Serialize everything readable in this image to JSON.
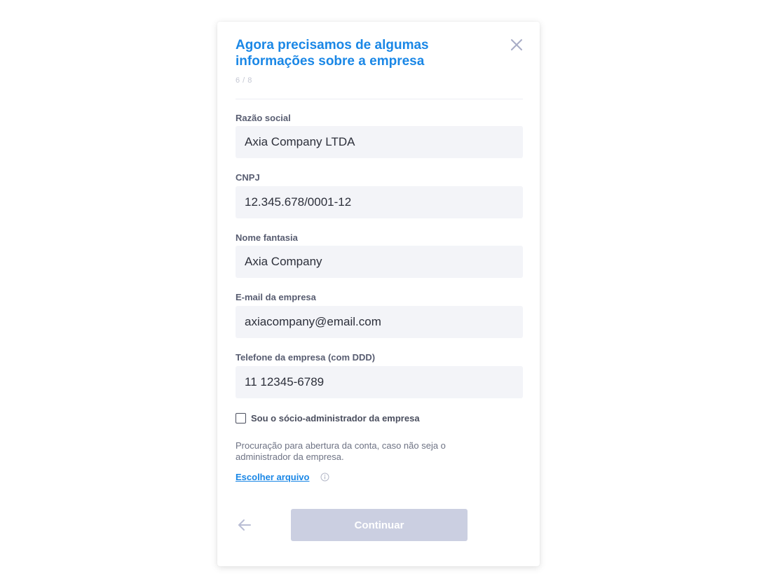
{
  "modal": {
    "title": "Agora precisamos de algumas informações sobre a empresa",
    "step": "6 / 8",
    "close_icon": "close-icon"
  },
  "form": {
    "fields": [
      {
        "label": "Razão social",
        "value": "Axia Company LTDA"
      },
      {
        "label": "CNPJ",
        "value": "12.345.678/0001-12"
      },
      {
        "label": "Nome fantasia",
        "value": "Axia Company"
      },
      {
        "label": "E-mail da empresa",
        "value": "axiacompany@email.com"
      },
      {
        "label": "Telefone da empresa (com DDD)",
        "value": "11 12345-6789"
      }
    ],
    "checkbox": {
      "label": "Sou o sócio-administrador da empresa",
      "checked": false
    },
    "help_text": "Procuração para abertura da conta, caso não seja o administrador da empresa.",
    "file_link": "Escolher arquivo",
    "info_icon": "info-icon"
  },
  "footer": {
    "back_icon": "arrow-left-icon",
    "continue_label": "Continuar"
  },
  "colors": {
    "accent": "#1a87e6",
    "input_bg": "#f3f4f8",
    "button_disabled": "#cbcfe1",
    "label": "#585d71"
  }
}
